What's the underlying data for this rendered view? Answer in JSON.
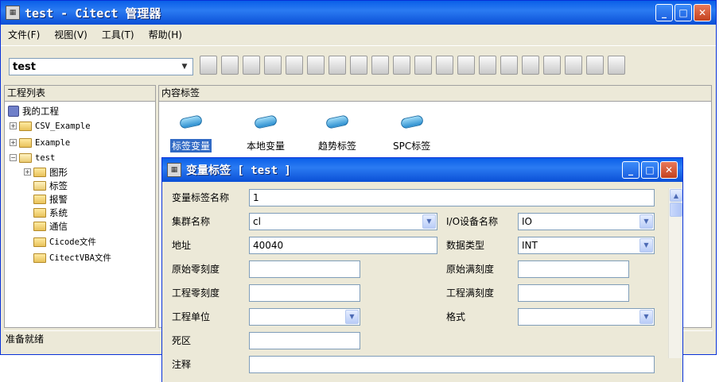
{
  "main_window": {
    "title": "test - Citect 管理器",
    "menus": [
      "文件(F)",
      "视图(V)",
      "工具(T)",
      "帮助(H)"
    ],
    "project_combo": "test",
    "toolbar_icons": [
      "tag-icon",
      "compile-icon",
      "run-icon",
      "edit-icon",
      "copy-icon",
      "print-icon",
      "pack-icon",
      "graphics-icon",
      "variable-icon",
      "trend-icon",
      "alarm-icon",
      "cicode-icon",
      "folder-icon",
      "restore-icon",
      "backup-icon",
      "properties-icon",
      "small-icons-icon",
      "list-icon",
      "details-icon",
      "help-icon"
    ],
    "left_pane_title": "工程列表",
    "right_pane_title": "内容标签",
    "status": "准备就绪"
  },
  "tree": {
    "root": "我的工程",
    "projects": [
      "CSV_Example",
      "Example",
      "test"
    ],
    "test_children": [
      "图形",
      "标签",
      "报警",
      "系统",
      "通信",
      "Cicode文件",
      "CitectVBA文件"
    ]
  },
  "content_items": [
    {
      "label": "标签变量",
      "icon": "variable-tag-icon",
      "selected": true
    },
    {
      "label": "本地变量",
      "icon": "local-variable-icon",
      "selected": false
    },
    {
      "label": "趋势标签",
      "icon": "trend-tag-icon",
      "selected": false
    },
    {
      "label": "SPC标签",
      "icon": "spc-tag-icon",
      "selected": false
    }
  ],
  "dialog": {
    "title": "变量标签 [ test ]",
    "fields": {
      "tag_name": {
        "label": "变量标签名称",
        "value": "1"
      },
      "cluster": {
        "label": "集群名称",
        "value": "cl"
      },
      "io_device": {
        "label": "I/O设备名称",
        "value": "IO"
      },
      "address": {
        "label": "地址",
        "value": "40040"
      },
      "data_type": {
        "label": "数据类型",
        "value": "INT"
      },
      "raw_zero": {
        "label": "原始零刻度",
        "value": ""
      },
      "raw_full": {
        "label": "原始满刻度",
        "value": ""
      },
      "eng_zero": {
        "label": "工程零刻度",
        "value": ""
      },
      "eng_full": {
        "label": "工程满刻度",
        "value": ""
      },
      "eng_units": {
        "label": "工程单位",
        "value": ""
      },
      "format": {
        "label": "格式",
        "value": ""
      },
      "deadband": {
        "label": "死区",
        "value": ""
      },
      "comment": {
        "label": "注释",
        "value": ""
      }
    }
  }
}
